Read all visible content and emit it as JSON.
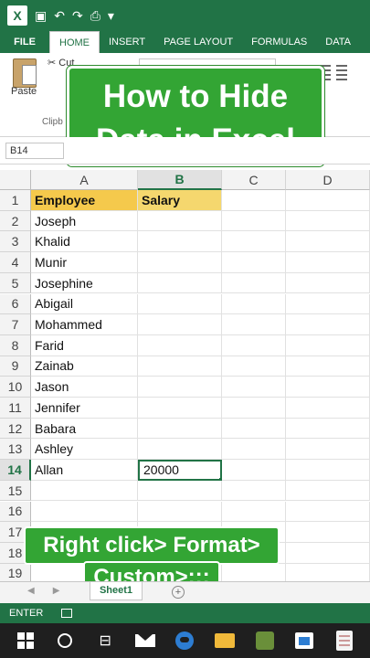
{
  "qat": {
    "app_icon": "excel-icon",
    "undo": "↶",
    "redo": "↷",
    "more": "▾"
  },
  "tabs": [
    "FILE",
    "HOME",
    "INSERT",
    "PAGE LAYOUT",
    "FORMULAS",
    "DATA"
  ],
  "active_tab": "HOME",
  "ribbon": {
    "paste": "Paste",
    "cut": "Cut",
    "clipboard": "Clipb"
  },
  "title_overlay": "How to Hide Data in Excel",
  "formula_bar": {
    "name_box": "B14"
  },
  "columns": [
    "A",
    "B",
    "C",
    "D"
  ],
  "selected_column": "B",
  "selected_row": "14",
  "rows": [
    {
      "n": "1",
      "a": "Employee",
      "b": "Salary"
    },
    {
      "n": "2",
      "a": "Joseph",
      "b": ""
    },
    {
      "n": "3",
      "a": "Khalid",
      "b": ""
    },
    {
      "n": "4",
      "a": "Munir",
      "b": ""
    },
    {
      "n": "5",
      "a": "Josephine",
      "b": ""
    },
    {
      "n": "6",
      "a": "Abigail",
      "b": ""
    },
    {
      "n": "7",
      "a": "Mohammed",
      "b": ""
    },
    {
      "n": "8",
      "a": "Farid",
      "b": ""
    },
    {
      "n": "9",
      "a": "Zainab",
      "b": ""
    },
    {
      "n": "10",
      "a": "Jason",
      "b": ""
    },
    {
      "n": "11",
      "a": "Jennifer",
      "b": ""
    },
    {
      "n": "12",
      "a": "Babara",
      "b": ""
    },
    {
      "n": "13",
      "a": "Ashley",
      "b": ""
    },
    {
      "n": "14",
      "a": "Allan",
      "b": "20000"
    },
    {
      "n": "15",
      "a": "",
      "b": ""
    },
    {
      "n": "16",
      "a": "",
      "b": ""
    },
    {
      "n": "17",
      "a": "",
      "b": ""
    },
    {
      "n": "18",
      "a": "",
      "b": ""
    },
    {
      "n": "19",
      "a": "",
      "b": ""
    }
  ],
  "instruction_overlay": {
    "line1": "Right click> Format>",
    "line2": "Custom>;;;"
  },
  "sheet_tab": "Sheet1",
  "add_sheet": "+",
  "status": {
    "mode": "ENTER"
  },
  "colors": {
    "excel_green": "#217346",
    "header_fill": "#f5c94c",
    "overlay_green": "#33a534"
  }
}
